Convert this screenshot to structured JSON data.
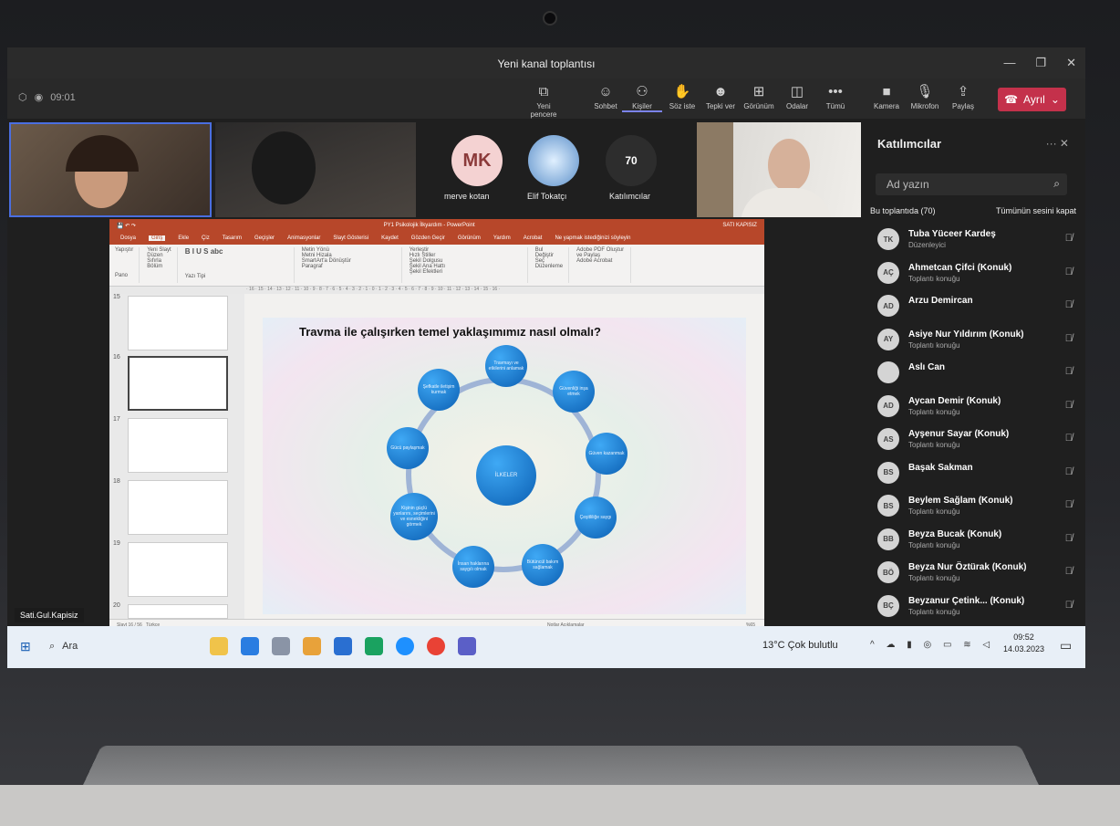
{
  "window": {
    "title": "Yeni kanal toplantısı",
    "timer": "09:01"
  },
  "toolbar": {
    "items": [
      {
        "label": "Yeni pencere",
        "icon": "new-window-icon"
      },
      {
        "label": "Sohbet",
        "icon": "chat-icon"
      },
      {
        "label": "Kişiler",
        "icon": "people-icon"
      },
      {
        "label": "Söz iste",
        "icon": "raise-hand-icon"
      },
      {
        "label": "Tepki ver",
        "icon": "react-icon"
      },
      {
        "label": "Görünüm",
        "icon": "view-icon"
      },
      {
        "label": "Odalar",
        "icon": "rooms-icon"
      },
      {
        "label": "Tümü",
        "icon": "more-icon"
      },
      {
        "label": "Kamera",
        "icon": "camera-icon"
      },
      {
        "label": "Mikrofon",
        "icon": "mic-off-icon"
      },
      {
        "label": "Paylaş",
        "icon": "share-icon"
      }
    ],
    "leave_label": "Ayrıl"
  },
  "gallery": {
    "avatars": [
      {
        "initials": "MK",
        "name": "merve kotan"
      },
      {
        "initials": "",
        "name": "Elif Tokatçı"
      },
      {
        "initials": "70",
        "name": "Katılımcılar"
      }
    ]
  },
  "presentation": {
    "window_title": "PY1 Psikolojik İlkyardım - PowerPoint",
    "user": "SATI KAPISIZ",
    "search_hint": "Ne yapmak istediğinizi söyleyin",
    "tabs": [
      "Dosya",
      "Giriş",
      "Ekle",
      "Çiz",
      "Tasarım",
      "Geçişler",
      "Animasyonlar",
      "Slayt Gösterisi",
      "Kaydet",
      "Gözden Geçir",
      "Görünüm",
      "Yardım",
      "Acrobat"
    ],
    "ribbon_groups": [
      "Pano",
      "Slaytlar",
      "Yazı Tipi",
      "Paragraf",
      "Çizim",
      "Düzenleme",
      "Adobe Acrobat"
    ],
    "ribbon_items": [
      "Yapıştır",
      "Yeni Slayt",
      "Düzen",
      "Sıfırla",
      "Bölüm",
      "Metin Yönü",
      "Metni Hizala",
      "SmartArt'a Dönüştür",
      "Yerleştir",
      "Hızlı Stiller",
      "Şekil Dolgusu",
      "Şekil Ana Hattı",
      "Şekil Efektleri",
      "Bul",
      "Değiştir",
      "Seç",
      "Adobe PDF Oluştur ve Paylaş"
    ],
    "thumbnail_numbers": [
      "15",
      "16",
      "17",
      "18",
      "19",
      "20"
    ],
    "slide": {
      "title": "Travma ile çalışırken temel yaklaşımımız nasıl olmalı?",
      "center": "İLKELER",
      "nodes": [
        "Travmayı ve etkilerini anlamak",
        "Güvenliği inşa etmek",
        "Güven kazanmak",
        "Çeşitliliğe saygı",
        "Bütüncül bakım sağlamak",
        "İnsan haklarına saygılı olmak",
        "Kişinin güçlü yanlarını, seçimlerini ve esnekliğini görmek",
        "Gücü paylaşmak",
        "Şefkatle iletişim kurmak"
      ]
    },
    "status_left": "Slayt 16 / 56",
    "status_mid": "Türkçe",
    "status_right": "Notlar   Açıklamalar",
    "zoom": "%65"
  },
  "presenter_name": "Sati.Gul.Kapisiz",
  "participants_panel": {
    "title": "Katılımcılar",
    "search_placeholder": "Ad yazın",
    "section": "Bu toplantıda (70)",
    "mute_all": "Tümünün sesini kapat",
    "people": [
      {
        "initials": "TK",
        "name": "Tuba Yüceer Kardeş",
        "role": "Düzenleyici"
      },
      {
        "initials": "AÇ",
        "name": "Ahmetcan Çifci (Konuk)",
        "role": "Toplantı konuğu"
      },
      {
        "initials": "AD",
        "name": "Arzu Demircan",
        "role": ""
      },
      {
        "initials": "AY",
        "name": "Asiye Nur Yıldırım (Konuk)",
        "role": "Toplantı konuğu"
      },
      {
        "initials": "",
        "name": "Aslı Can",
        "role": ""
      },
      {
        "initials": "AD",
        "name": "Aycan Demir (Konuk)",
        "role": "Toplantı konuğu"
      },
      {
        "initials": "AS",
        "name": "Ayşenur Sayar (Konuk)",
        "role": "Toplantı konuğu"
      },
      {
        "initials": "BS",
        "name": "Başak Sakman",
        "role": ""
      },
      {
        "initials": "BS",
        "name": "Beylem Sağlam (Konuk)",
        "role": "Toplantı konuğu"
      },
      {
        "initials": "BB",
        "name": "Beyza Bucak (Konuk)",
        "role": "Toplantı konuğu"
      },
      {
        "initials": "BÖ",
        "name": "Beyza Nur Öztürak (Konuk)",
        "role": "Toplantı konuğu"
      },
      {
        "initials": "BÇ",
        "name": "Beyzanur Çetink... (Konuk)",
        "role": "Toplantı konuğu"
      }
    ]
  },
  "taskbar": {
    "search": "Ara",
    "weather": "13°C  Çok bulutlu",
    "time": "09:52",
    "date": "14.03.2023"
  }
}
